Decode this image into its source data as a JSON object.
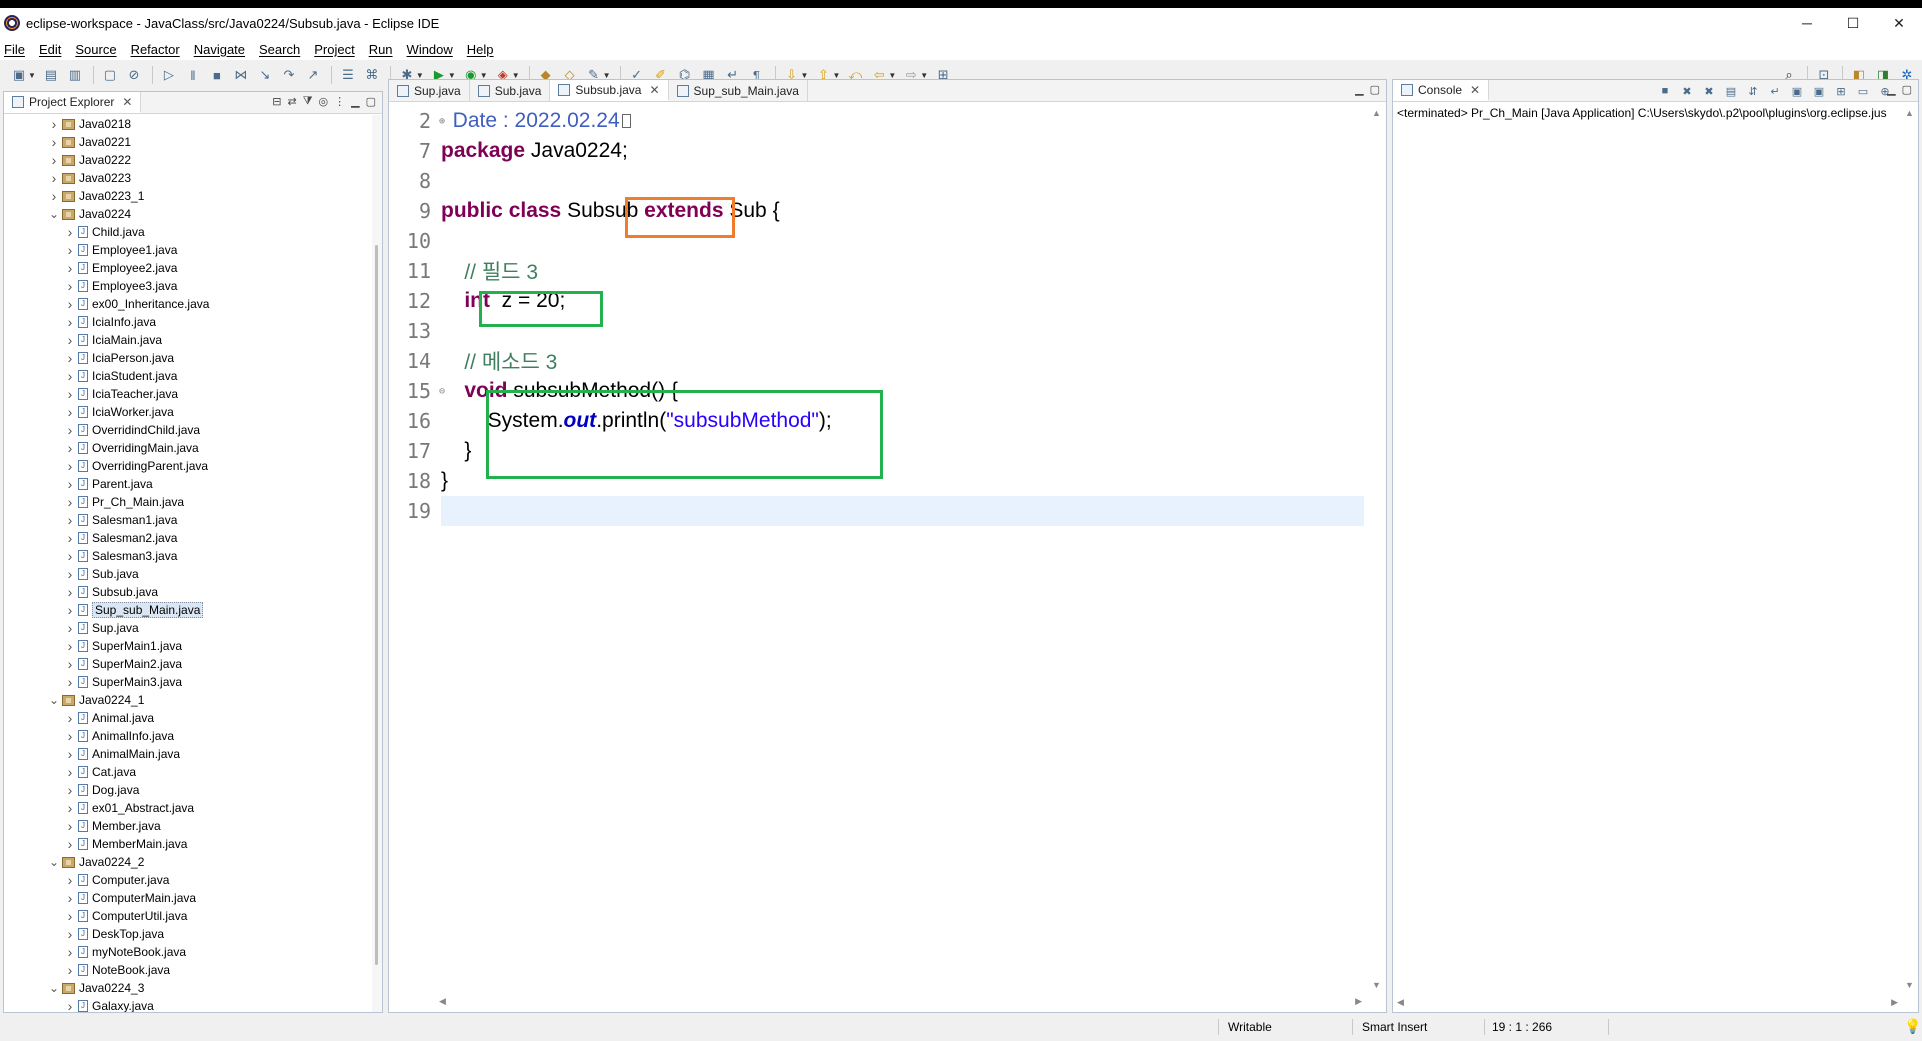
{
  "window": {
    "title": "eclipse-workspace - JavaClass/src/Java0224/Subsub.java - Eclipse IDE",
    "minimize": "─",
    "maximize": "☐",
    "close": "✕"
  },
  "menu": [
    "File",
    "Edit",
    "Source",
    "Refactor",
    "Navigate",
    "Search",
    "Project",
    "Run",
    "Window",
    "Help"
  ],
  "explorer": {
    "tab_label": "Project Explorer",
    "tree": [
      {
        "label": "Java0218",
        "type": "package",
        "level": 0,
        "expanded": false
      },
      {
        "label": "Java0221",
        "type": "package",
        "level": 0,
        "expanded": false
      },
      {
        "label": "Java0222",
        "type": "package",
        "level": 0,
        "expanded": false
      },
      {
        "label": "Java0223",
        "type": "package",
        "level": 0,
        "expanded": false
      },
      {
        "label": "Java0223_1",
        "type": "package",
        "level": 0,
        "expanded": false
      },
      {
        "label": "Java0224",
        "type": "package",
        "level": 0,
        "expanded": true
      },
      {
        "label": "Child.java",
        "type": "file",
        "level": 1
      },
      {
        "label": "Employee1.java",
        "type": "file",
        "level": 1
      },
      {
        "label": "Employee2.java",
        "type": "file",
        "level": 1
      },
      {
        "label": "Employee3.java",
        "type": "file",
        "level": 1
      },
      {
        "label": "ex00_Inheritance.java",
        "type": "file",
        "level": 1
      },
      {
        "label": "IciaInfo.java",
        "type": "file",
        "level": 1
      },
      {
        "label": "IciaMain.java",
        "type": "file",
        "level": 1
      },
      {
        "label": "IciaPerson.java",
        "type": "file",
        "level": 1
      },
      {
        "label": "IciaStudent.java",
        "type": "file",
        "level": 1
      },
      {
        "label": "IciaTeacher.java",
        "type": "file",
        "level": 1
      },
      {
        "label": "IciaWorker.java",
        "type": "file",
        "level": 1
      },
      {
        "label": "OverridindChild.java",
        "type": "file",
        "level": 1
      },
      {
        "label": "OverridingMain.java",
        "type": "file",
        "level": 1
      },
      {
        "label": "OverridingParent.java",
        "type": "file",
        "level": 1
      },
      {
        "label": "Parent.java",
        "type": "file",
        "level": 1
      },
      {
        "label": "Pr_Ch_Main.java",
        "type": "file",
        "level": 1
      },
      {
        "label": "Salesman1.java",
        "type": "file",
        "level": 1
      },
      {
        "label": "Salesman2.java",
        "type": "file",
        "level": 1
      },
      {
        "label": "Salesman3.java",
        "type": "file",
        "level": 1
      },
      {
        "label": "Sub.java",
        "type": "file",
        "level": 1
      },
      {
        "label": "Subsub.java",
        "type": "file",
        "level": 1
      },
      {
        "label": "Sup_sub_Main.java",
        "type": "file",
        "level": 1,
        "selected": true
      },
      {
        "label": "Sup.java",
        "type": "file",
        "level": 1
      },
      {
        "label": "SuperMain1.java",
        "type": "file",
        "level": 1
      },
      {
        "label": "SuperMain2.java",
        "type": "file",
        "level": 1
      },
      {
        "label": "SuperMain3.java",
        "type": "file",
        "level": 1
      },
      {
        "label": "Java0224_1",
        "type": "package",
        "level": 0,
        "expanded": true
      },
      {
        "label": "Animal.java",
        "type": "file",
        "level": 1
      },
      {
        "label": "AnimalInfo.java",
        "type": "file",
        "level": 1
      },
      {
        "label": "AnimalMain.java",
        "type": "file",
        "level": 1
      },
      {
        "label": "Cat.java",
        "type": "file",
        "level": 1
      },
      {
        "label": "Dog.java",
        "type": "file",
        "level": 1
      },
      {
        "label": "ex01_Abstract.java",
        "type": "file",
        "level": 1
      },
      {
        "label": "Member.java",
        "type": "file",
        "level": 1
      },
      {
        "label": "MemberMain.java",
        "type": "file",
        "level": 1
      },
      {
        "label": "Java0224_2",
        "type": "package",
        "level": 0,
        "expanded": true
      },
      {
        "label": "Computer.java",
        "type": "file",
        "level": 1
      },
      {
        "label": "ComputerMain.java",
        "type": "file",
        "level": 1
      },
      {
        "label": "ComputerUtil.java",
        "type": "file",
        "level": 1
      },
      {
        "label": "DeskTop.java",
        "type": "file",
        "level": 1
      },
      {
        "label": "myNoteBook.java",
        "type": "file",
        "level": 1
      },
      {
        "label": "NoteBook.java",
        "type": "file",
        "level": 1
      },
      {
        "label": "Java0224_3",
        "type": "package",
        "level": 0,
        "expanded": true
      },
      {
        "label": "Galaxy.java",
        "type": "file",
        "level": 1
      }
    ]
  },
  "editor": {
    "tabs": [
      {
        "label": "Sup.java",
        "active": false
      },
      {
        "label": "Sub.java",
        "active": false
      },
      {
        "label": "Subsub.java",
        "active": true
      },
      {
        "label": "Sup_sub_Main.java",
        "active": false
      }
    ],
    "line_numbers": [
      "2",
      "7",
      "8",
      "9",
      "10",
      "11",
      "12",
      "13",
      "14",
      "15",
      "16",
      "17",
      "18",
      "19"
    ],
    "code": {
      "l2": "  Date : 2022.02.24",
      "l7_kw": "package",
      "l7_rest": " Java0224;",
      "l9_kw1": "public",
      "l9_kw2": "class",
      "l9_name": " Subsub ",
      "l9_ext": "extends",
      "l9_sup": " Sub",
      "l9_brace": " {",
      "l11": "    // 필드 3",
      "l12_kw": "int",
      "l12_rest": "  z = 20;",
      "l14": "    // 메소드 3",
      "l15_kw": "void",
      "l15_rest": " subsubMethod() {",
      "l16_a": "        System.",
      "l16_out": "out",
      "l16_b": ".println(",
      "l16_str": "\"subsubMethod\"",
      "l16_c": ");",
      "l17": "    }",
      "l18": "}"
    }
  },
  "console": {
    "tab_label": "Console",
    "header": "<terminated> Pr_Ch_Main [Java Application] C:\\Users\\skydo\\.p2\\pool\\plugins\\org.eclipse.jus"
  },
  "status": {
    "writable": "Writable",
    "insert_mode": "Smart Insert",
    "position": "19 : 1 : 266"
  },
  "colors": {
    "keyword": "#7f0055",
    "comment": "#3f7f5f",
    "string": "#2a00ff",
    "highlight_orange": "#f07d2b",
    "highlight_green": "#23b14d"
  }
}
